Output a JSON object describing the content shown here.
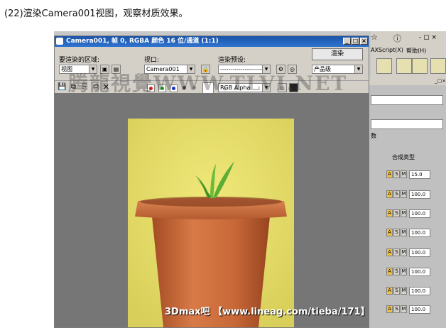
{
  "caption": "(22)渲染Camera001视图，观察材质效果。",
  "window": {
    "title": "Camera001, 帧 0, RGBA 颜色 16 位/通道 (1:1)",
    "controls": [
      "_",
      "□",
      "×"
    ]
  },
  "toolbar": {
    "area_label": "要渲染的区域:",
    "area_value": "视图",
    "viewport_label": "视口:",
    "viewport_value": "Camera001",
    "preset_label": "渲染预设:",
    "preset_value": "---------------------",
    "render_button": "渲染",
    "quality_value": "产品级",
    "channel_value": "RGB Alpha"
  },
  "background_app": {
    "menu_items": [
      "AXScript(X)",
      "帮助(H)"
    ],
    "panel_header": "数",
    "composite_label": "合成类型",
    "rows": [
      {
        "A": "A",
        "S": "S",
        "M": "M",
        "value": "15.0"
      },
      {
        "A": "A",
        "S": "S",
        "M": "M",
        "value": "100.0"
      },
      {
        "A": "A",
        "S": "S",
        "M": "M",
        "value": "100.0"
      },
      {
        "A": "A",
        "S": "S",
        "M": "M",
        "value": "100.0"
      },
      {
        "A": "A",
        "S": "S",
        "M": "M",
        "value": "100.0"
      },
      {
        "A": "A",
        "S": "S",
        "M": "M",
        "value": "100.0"
      },
      {
        "A": "A",
        "S": "S",
        "M": "M",
        "value": "100.0"
      },
      {
        "A": "A",
        "S": "S",
        "M": "M",
        "value": "100.0"
      }
    ]
  },
  "watermarks": {
    "top": "腾龍視覺WWW.TLVI.NET",
    "bottom": "3Dmax吧 【www.lineag.com/tieba/171】"
  },
  "colors": {
    "title_bar": "#2f74d0",
    "render_bg": "#767676",
    "pot": "#c8683a",
    "backdrop": "#e6dd6a",
    "plant": "#5fae38"
  }
}
